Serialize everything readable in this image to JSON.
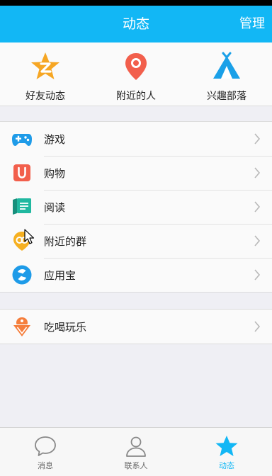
{
  "header": {
    "title": "动态",
    "manage_label": "管理"
  },
  "quick_entries": [
    {
      "label": "好友动态",
      "icon": "qzone-star-icon",
      "color": "#f6a623"
    },
    {
      "label": "附近的人",
      "icon": "location-pin-icon",
      "color": "#f25f4c"
    },
    {
      "label": "兴趣部落",
      "icon": "tent-icon",
      "color": "#1aa0e8"
    }
  ],
  "list_group_1": [
    {
      "label": "游戏",
      "icon": "gamepad-icon",
      "color": "#1e9be8"
    },
    {
      "label": "购物",
      "icon": "shopping-bag-icon",
      "color": "#f25f4c"
    },
    {
      "label": "阅读",
      "icon": "book-icon",
      "color": "#20b8a0"
    },
    {
      "label": "附近的群",
      "icon": "nearby-group-icon",
      "color": "#f6b020"
    },
    {
      "label": "应用宝",
      "icon": "app-store-icon",
      "color": "#1e9be8"
    }
  ],
  "list_group_2": [
    {
      "label": "吃喝玩乐",
      "icon": "ice-cream-icon",
      "color": "#f57e3c"
    }
  ],
  "tabbar": [
    {
      "label": "消息",
      "icon": "message-bubble-icon",
      "active": false
    },
    {
      "label": "联系人",
      "icon": "contact-person-icon",
      "active": false
    },
    {
      "label": "动态",
      "icon": "star-icon",
      "active": true
    }
  ],
  "colors": {
    "accent": "#12b7f5",
    "background": "#efeff4"
  }
}
